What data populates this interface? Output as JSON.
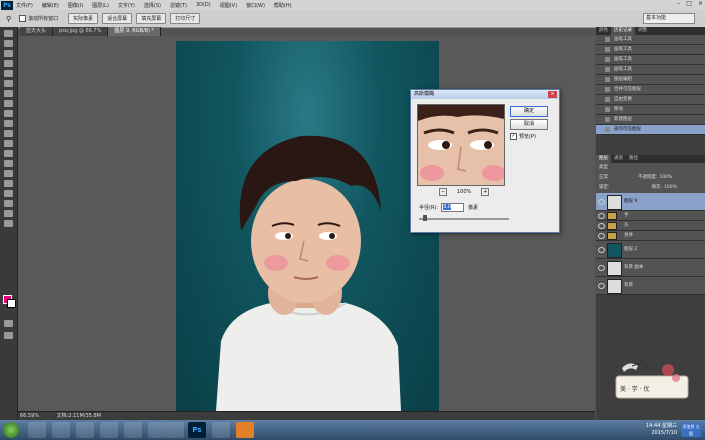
{
  "app": {
    "logo": "Ps"
  },
  "menu": [
    "文件(F)",
    "编辑(E)",
    "图像(I)",
    "图层(L)",
    "文字(Y)",
    "选择(S)",
    "滤镜(T)",
    "3D(D)",
    "视图(V)",
    "窗口(W)",
    "帮助(H)"
  ],
  "options": {
    "checkbox_label": "滚动所有窗口",
    "buttons": [
      "实际像素",
      "适合屏幕",
      "填充屏幕",
      "打印尺寸"
    ],
    "workspace": "基本功能"
  },
  "doc_tabs": [
    "蓝天大头",
    "psq.jpg @ 66.7%",
    "图层 9, RGB/8) *"
  ],
  "statusbar": {
    "zoom": "66.59%",
    "doc": "文档:2.11M/35.8M"
  },
  "panels": {
    "top_tabs": [
      "颜色",
      "历史记录",
      "调整"
    ],
    "history": [
      "画笔工具",
      "画笔工具",
      "画笔工具",
      "画笔工具",
      "图层编组",
      "合并可见图层",
      "自由变换",
      "移动",
      "新建图层",
      "盖印可见图层"
    ],
    "layers_tabs": [
      "图层",
      "通道",
      "路径"
    ],
    "kind": "类型",
    "blend": "正常",
    "opacity_label": "不透明度:",
    "opacity": "100%",
    "lock_label": "锁定:",
    "fill_label": "填充:",
    "fill": "100%",
    "layers": [
      "图层 9",
      "手",
      "头",
      "身体",
      "图层 2",
      "背景 副本",
      "背景"
    ]
  },
  "dialog": {
    "title": "高斯模糊",
    "ok": "确定",
    "cancel": "取消",
    "preview_label": "预览(P)",
    "zoom": "100%",
    "radius_label": "半径(R):",
    "radius_value": "3.0",
    "unit": "像素"
  },
  "taskbar": {
    "time": "14:44 星期三",
    "date": "2015/7/10",
    "tray_text": "添加到 大图"
  },
  "watermark": "美 · 学 · 优"
}
